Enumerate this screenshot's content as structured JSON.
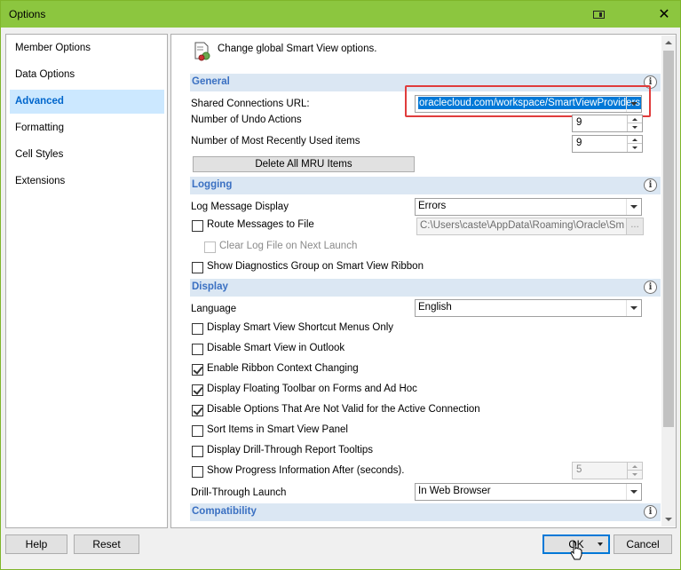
{
  "window": {
    "title": "Options"
  },
  "nav": {
    "items": [
      {
        "label": "Member Options",
        "selected": false
      },
      {
        "label": "Data Options",
        "selected": false
      },
      {
        "label": "Advanced",
        "selected": true
      },
      {
        "label": "Formatting",
        "selected": false
      },
      {
        "label": "Cell Styles",
        "selected": false
      },
      {
        "label": "Extensions",
        "selected": false
      }
    ]
  },
  "header": {
    "text": "Change global Smart View options."
  },
  "general": {
    "title": "General",
    "shared_url_label": "Shared Connections URL:",
    "shared_url_value": "oraclecloud.com/workspace/SmartViewProviders",
    "undo_label": "Number of Undo Actions",
    "undo_value": "9",
    "mru_label": "Number of Most Recently Used items",
    "mru_value": "9",
    "delete_mru_label": "Delete All MRU Items"
  },
  "logging": {
    "title": "Logging",
    "log_display_label": "Log Message Display",
    "log_display_value": "Errors",
    "route_label": "Route Messages to File",
    "route_checked": false,
    "log_path": "C:\\Users\\caste\\AppData\\Roaming\\Oracle\\SmartView",
    "browse_label": "...",
    "clear_label": "Clear Log File on Next Launch",
    "diagnostics_label": "Show Diagnostics Group on Smart View Ribbon"
  },
  "display": {
    "title": "Display",
    "language_label": "Language",
    "language_value": "English",
    "options": [
      {
        "label": "Display Smart View Shortcut Menus Only",
        "checked": false
      },
      {
        "label": "Disable Smart View in Outlook",
        "checked": false
      },
      {
        "label": "Enable Ribbon Context Changing",
        "checked": true
      },
      {
        "label": "Display Floating Toolbar on Forms and Ad Hoc",
        "checked": true
      },
      {
        "label": "Disable Options That Are Not Valid for the Active Connection",
        "checked": true
      },
      {
        "label": "Sort Items in Smart View Panel",
        "checked": false
      },
      {
        "label": "Display Drill-Through Report Tooltips",
        "checked": false
      },
      {
        "label": "Show Progress Information After (seconds).",
        "checked": false
      }
    ],
    "progress_value": "5",
    "drill_label": "Drill-Through Launch",
    "drill_value": "In Web Browser"
  },
  "compatibility": {
    "title": "Compatibility"
  },
  "buttons": {
    "help": "Help",
    "reset": "Reset",
    "ok": "OK",
    "cancel": "Cancel"
  },
  "colors": {
    "titlebar": "#8cc63f",
    "section_bg": "#dbe7f3",
    "section_title": "#3a70c2",
    "selection": "#0078d7",
    "highlight": "#e03c3c"
  }
}
